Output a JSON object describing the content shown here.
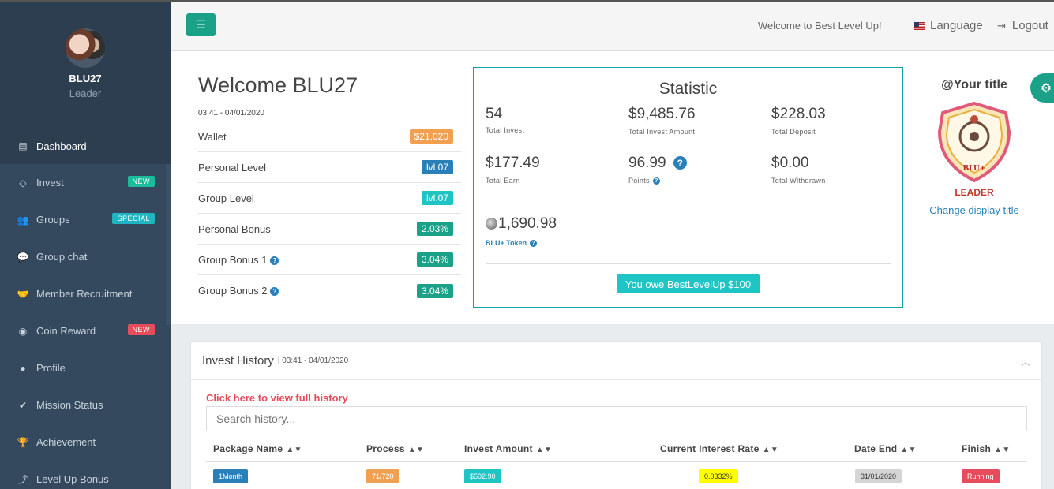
{
  "user": {
    "name": "BLU27",
    "role": "Leader"
  },
  "sidebar": {
    "items": [
      {
        "label": "Dashboard",
        "icon": "dashboard-icon",
        "badge": ""
      },
      {
        "label": "Invest",
        "icon": "diamond-icon",
        "badge": "NEW"
      },
      {
        "label": "Groups",
        "icon": "users-icon",
        "badge": "SPECIAL"
      },
      {
        "label": "Group chat",
        "icon": "chat-icon",
        "badge": ""
      },
      {
        "label": "Member Recruitment",
        "icon": "handshake-icon",
        "badge": ""
      },
      {
        "label": "Coin Reward",
        "icon": "coins-icon",
        "badge": "NEW"
      },
      {
        "label": "Profile",
        "icon": "user-icon",
        "badge": ""
      },
      {
        "label": "Mission Status",
        "icon": "check-circle-icon",
        "badge": ""
      },
      {
        "label": "Achievement",
        "icon": "trophy-icon",
        "badge": ""
      },
      {
        "label": "Level Up Bonus",
        "icon": "level-up-icon",
        "badge": ""
      }
    ]
  },
  "topbar": {
    "welcome": "Welcome to Best Level Up!",
    "language": "Language",
    "logout": "Logout"
  },
  "welcome": {
    "title": "Welcome BLU27",
    "datetime": "03:41 - 04/01/2020",
    "rows": [
      {
        "label": "Wallet",
        "value": "$21.020",
        "color": "#f0a050",
        "help": false
      },
      {
        "label": "Personal Level",
        "value": "lvl.07",
        "color": "#2980b9",
        "help": false
      },
      {
        "label": "Group Level",
        "value": "lvl.07",
        "color": "#1fc4c4",
        "help": false
      },
      {
        "label": "Personal Bonus",
        "value": "2.03%",
        "color": "#1aa188",
        "help": false
      },
      {
        "label": "Group Bonus 1",
        "value": "3.04%",
        "color": "#1aa188",
        "help": true
      },
      {
        "label": "Group Bonus 2",
        "value": "3.04%",
        "color": "#1aa188",
        "help": true
      }
    ]
  },
  "statistic": {
    "title": "Statistic",
    "total_invest": {
      "value": "54",
      "label": "Total Invest"
    },
    "total_invest_amount": {
      "value": "$9,485.76",
      "label": "Total Invest Amount"
    },
    "total_deposit": {
      "value": "$228.03",
      "label": "Total Deposit"
    },
    "total_earn": {
      "value": "$177.49",
      "label": "Total Earn"
    },
    "points": {
      "value": "96.99",
      "label": "Points"
    },
    "total_withdrawn": {
      "value": "$0.00",
      "label": "Total Withdrawn"
    },
    "token": {
      "value": "1,690.98",
      "label": "BLU+ Token"
    },
    "owe_button": "You owe BestLevelUp $100"
  },
  "title_box": {
    "heading": "@Your title",
    "badge_text": "BLU+",
    "leader": "LEADER",
    "change": "Change display title"
  },
  "history": {
    "title": "Invest History",
    "datetime": "| 03:41 - 04/01/2020",
    "full_link": "Click here to view full history",
    "search_placeholder": "Search history...",
    "columns": [
      "Package Name",
      "Process",
      "Invest Amount",
      "Current Interest Rate",
      "Date End",
      "Finish"
    ],
    "rows": [
      {
        "package": "1Month",
        "process": "71/720",
        "amount": "$502.90",
        "rate": "0.0332%",
        "date_end": "31/01/2020",
        "finish": "Running"
      }
    ]
  },
  "colors": {
    "accent": "#1aa188",
    "sidebar_bg": "#2c3e50",
    "link": "#2980b9",
    "danger": "#e74c5c"
  }
}
